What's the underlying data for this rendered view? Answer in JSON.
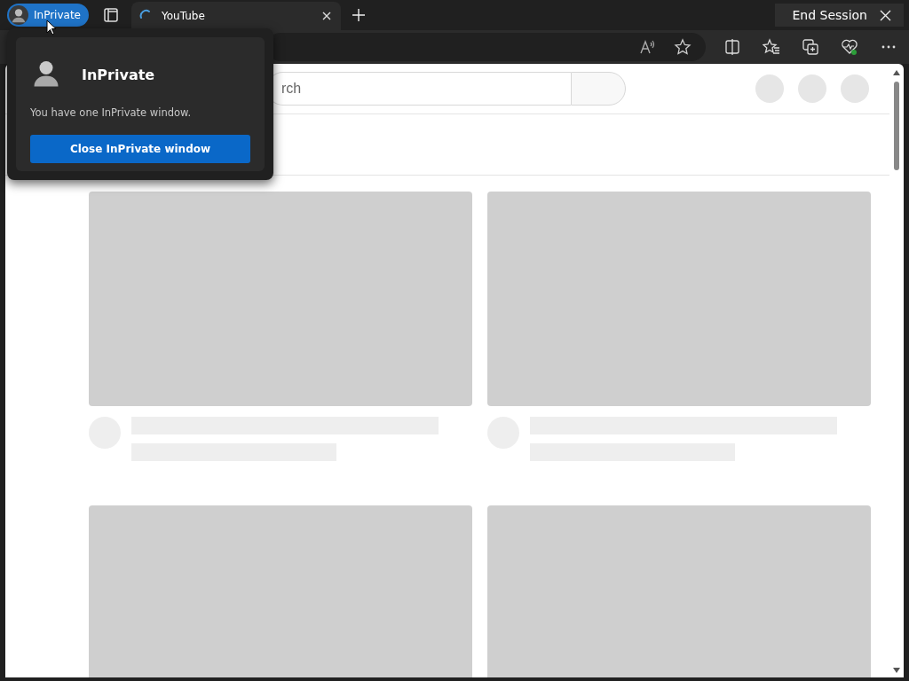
{
  "inprivate_badge": {
    "label": "InPrivate"
  },
  "tabs": [
    {
      "title": "YouTube",
      "selected": true,
      "loading": true
    }
  ],
  "end_session": {
    "label": "End Session"
  },
  "page": {
    "search": {
      "placeholder": "rch"
    },
    "cards": [
      {
        "kind": "placeholder"
      },
      {
        "kind": "placeholder"
      },
      {
        "kind": "thumbnail"
      },
      {
        "kind": "thumbnail"
      }
    ]
  },
  "popup": {
    "title": "InPrivate",
    "message": "You have one InPrivate window.",
    "button": "Close InPrivate window"
  }
}
